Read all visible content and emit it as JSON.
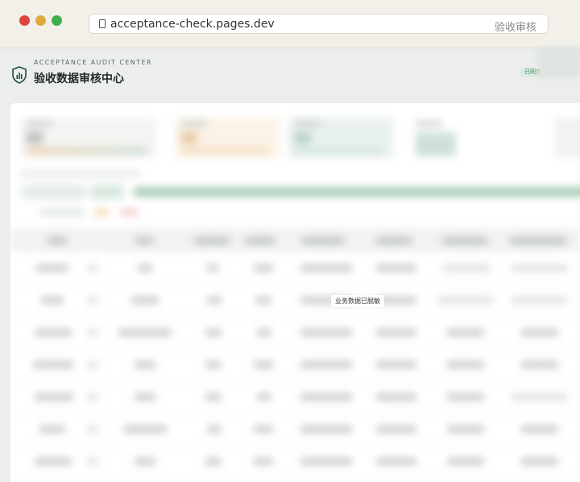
{
  "browser": {
    "url": "acceptance-check.pages.dev",
    "tab_title": "验收审核"
  },
  "header": {
    "subtitle": "ACCEPTANCE AUDIT CENTER",
    "title": "验收数据审核中心",
    "badge": "已同步"
  },
  "overlay": {
    "message": "业务数据已脱敏"
  },
  "colors": {
    "accent": "#a9ccb6",
    "brand_dark": "#1f4a43"
  }
}
